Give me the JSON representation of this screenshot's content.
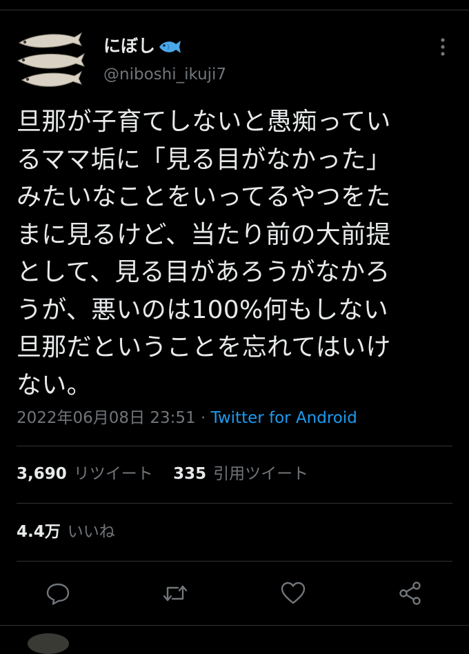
{
  "author": {
    "display_name": "にぼし",
    "name_emoji_icon": "fish-emoji",
    "handle": "@niboshi_ikuji7",
    "avatar_icon": "dried-sardines-avatar"
  },
  "tweet": {
    "lines": [
      "旦那が子育てしないと愚痴ってい",
      "るママ垢に「見る目がなかった」",
      "みたいなことをいってるやつをた",
      "まに見るけど、当たり前の大前提",
      "として、見る目があろうがなかろ",
      "うが、悪いのは100%何もしない",
      "旦那だということを忘れてはいけ",
      "ない。"
    ],
    "timestamp": "2022年06月08日 23:51",
    "separator": "·",
    "source": "Twitter for Android"
  },
  "stats": {
    "retweets_count": "3,690",
    "retweets_label": "リツイート",
    "quotes_count": "335",
    "quotes_label": "引用ツイート",
    "likes_count": "4.4万",
    "likes_label": "いいね"
  },
  "actions": [
    "reply-icon",
    "retweet-icon",
    "like-icon",
    "share-icon"
  ],
  "colors": {
    "background": "#000000",
    "text": "#e7e9ea",
    "muted": "#71767b",
    "link": "#1d9bf0",
    "divider": "#2f3336"
  }
}
